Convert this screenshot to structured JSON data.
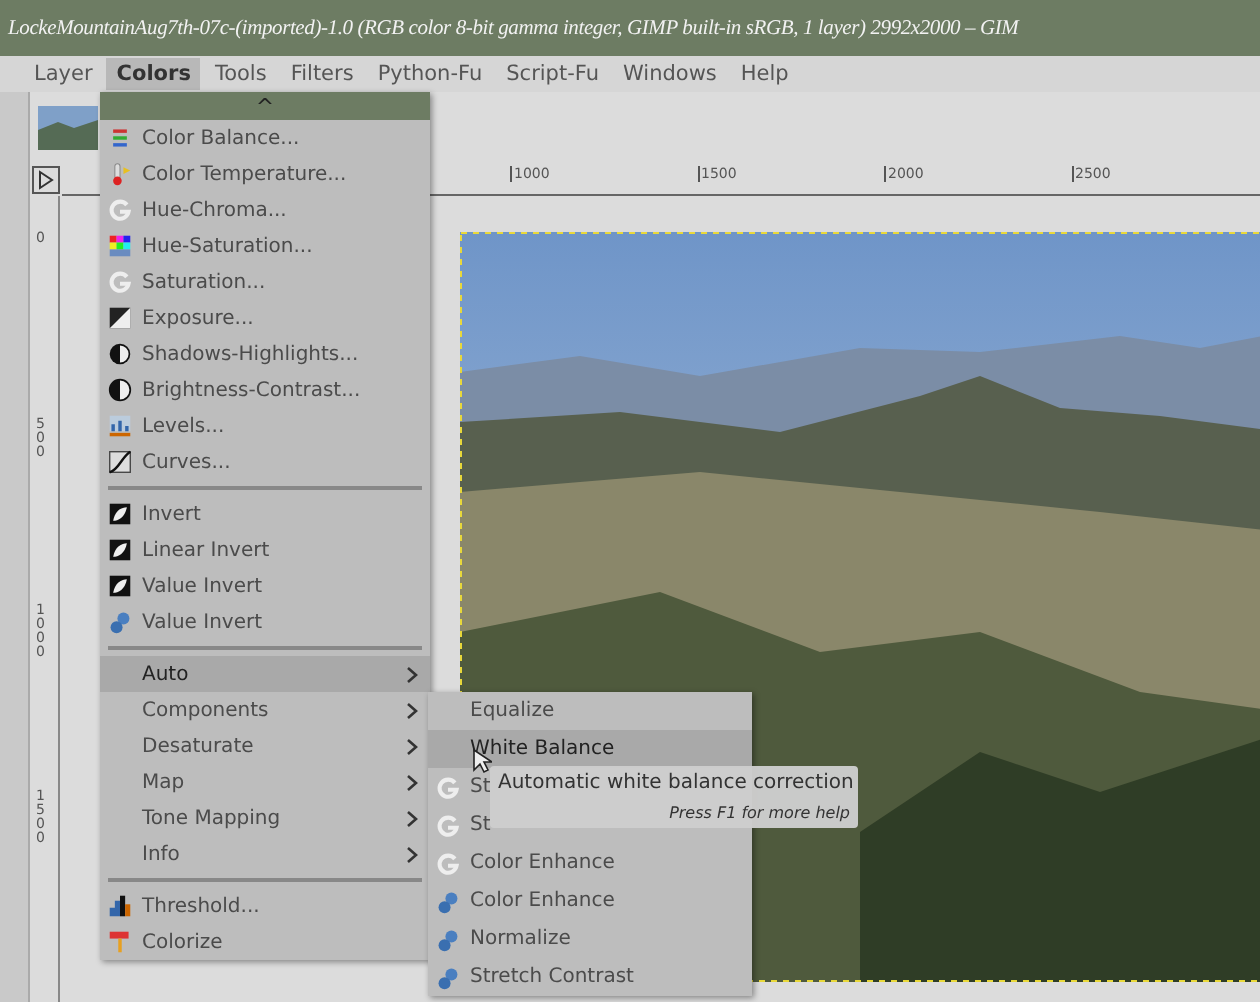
{
  "window": {
    "title": "LockeMountainAug7th-07c-(imported)-1.0 (RGB color 8-bit gamma integer, GIMP built-in sRGB, 1 layer) 2992x2000 – GIM"
  },
  "menubar": [
    {
      "label": "Layer",
      "selected": false
    },
    {
      "label": "Colors",
      "selected": true
    },
    {
      "label": "Tools",
      "selected": false
    },
    {
      "label": "Filters",
      "selected": false
    },
    {
      "label": "Python-Fu",
      "selected": false
    },
    {
      "label": "Script-Fu",
      "selected": false
    },
    {
      "label": "Windows",
      "selected": false
    },
    {
      "label": "Help",
      "selected": false
    }
  ],
  "top_ruler": [
    "1000",
    "1500",
    "2000",
    "2500"
  ],
  "left_ruler": [
    "0",
    "500",
    "1000",
    "1500"
  ],
  "colors_menu": {
    "scroll_arrow": "^",
    "items": [
      {
        "kind": "item",
        "label": "Color Balance...",
        "selected": false
      },
      {
        "kind": "item",
        "label": "Color Temperature...",
        "selected": false
      },
      {
        "kind": "item",
        "label": "Hue-Chroma...",
        "selected": false
      },
      {
        "kind": "item",
        "label": "Hue-Saturation...",
        "selected": false
      },
      {
        "kind": "item",
        "label": "Saturation...",
        "selected": false
      },
      {
        "kind": "item",
        "label": "Exposure...",
        "selected": false
      },
      {
        "kind": "item",
        "label": "Shadows-Highlights...",
        "selected": false
      },
      {
        "kind": "item",
        "label": "Brightness-Contrast...",
        "selected": false
      },
      {
        "kind": "item",
        "label": "Levels...",
        "selected": false
      },
      {
        "kind": "item",
        "label": "Curves...",
        "selected": false
      },
      {
        "kind": "separator"
      },
      {
        "kind": "item",
        "label": "Invert",
        "selected": false
      },
      {
        "kind": "item",
        "label": "Linear Invert",
        "selected": false
      },
      {
        "kind": "item",
        "label": "Value Invert",
        "selected": false
      },
      {
        "kind": "item",
        "label": "Value Invert",
        "selected": false
      },
      {
        "kind": "separator"
      },
      {
        "kind": "submenu",
        "label": "Auto",
        "selected": true
      },
      {
        "kind": "submenu",
        "label": "Components",
        "selected": false
      },
      {
        "kind": "submenu",
        "label": "Desaturate",
        "selected": false
      },
      {
        "kind": "submenu",
        "label": "Map",
        "selected": false
      },
      {
        "kind": "submenu",
        "label": "Tone Mapping",
        "selected": false
      },
      {
        "kind": "submenu",
        "label": "Info",
        "selected": false
      },
      {
        "kind": "separator"
      },
      {
        "kind": "item",
        "label": "Threshold...",
        "selected": false
      },
      {
        "kind": "item",
        "label": "Colorize",
        "selected": false
      }
    ]
  },
  "auto_submenu": [
    {
      "label": "Equalize",
      "selected": false
    },
    {
      "label": "White Balance",
      "selected": true
    },
    {
      "label": "St",
      "selected": false
    },
    {
      "label": "St",
      "selected": false
    },
    {
      "label": "Color Enhance",
      "selected": false
    },
    {
      "label": "Color Enhance",
      "selected": false
    },
    {
      "label": "Normalize",
      "selected": false
    },
    {
      "label": "Stretch Contrast",
      "selected": false
    }
  ],
  "tooltip": {
    "text": "Automatic white balance correction",
    "help": "Press F1 for more help"
  }
}
